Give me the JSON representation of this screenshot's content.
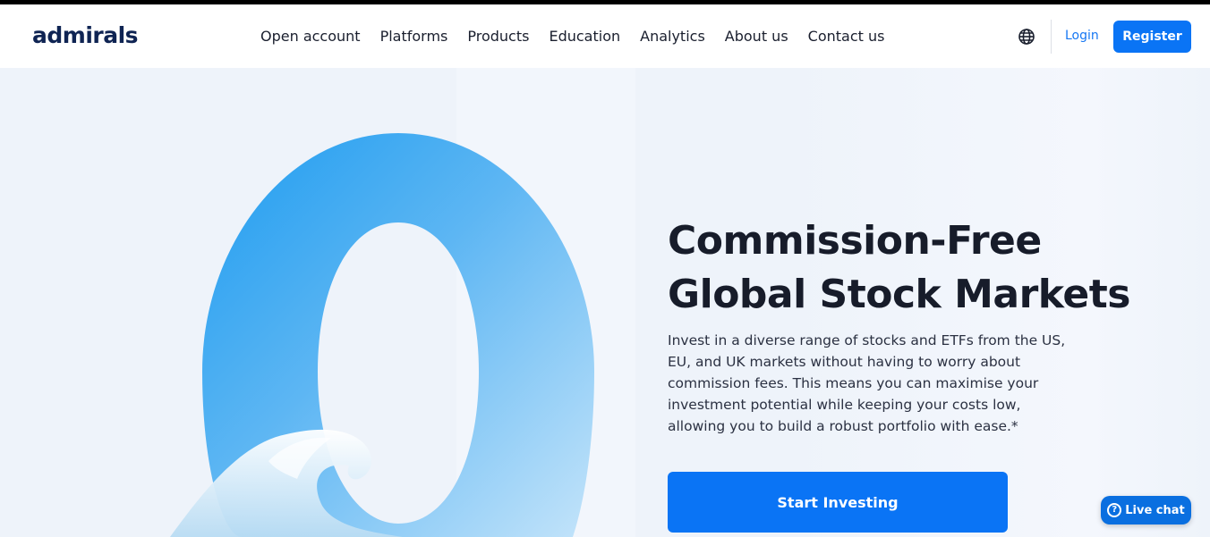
{
  "header": {
    "logo": "admirals",
    "nav": [
      "Open account",
      "Platforms",
      "Products",
      "Education",
      "Analytics",
      "About us",
      "Contact us"
    ],
    "login_label": "Login",
    "register_label": "Register"
  },
  "hero": {
    "headline_line1": "Commission-Free",
    "headline_line2": "Global Stock Markets",
    "description": "Invest in a diverse range of stocks and ETFs from the US, EU, and UK markets without having to worry about commission fees. This means you can maximise your investment potential while keeping your costs low, allowing you to build a robust portfolio with ease.*",
    "cta_label": "Start Investing"
  },
  "chat": {
    "label": "Live chat",
    "icon_glyph": "?"
  },
  "icons": {
    "globe": "globe-icon",
    "chat": "help-circle-icon"
  },
  "colors": {
    "brand_blue": "#0a74f5",
    "logo_navy": "#0f2453",
    "headline": "#171c2a",
    "background": "#eef3fa"
  }
}
